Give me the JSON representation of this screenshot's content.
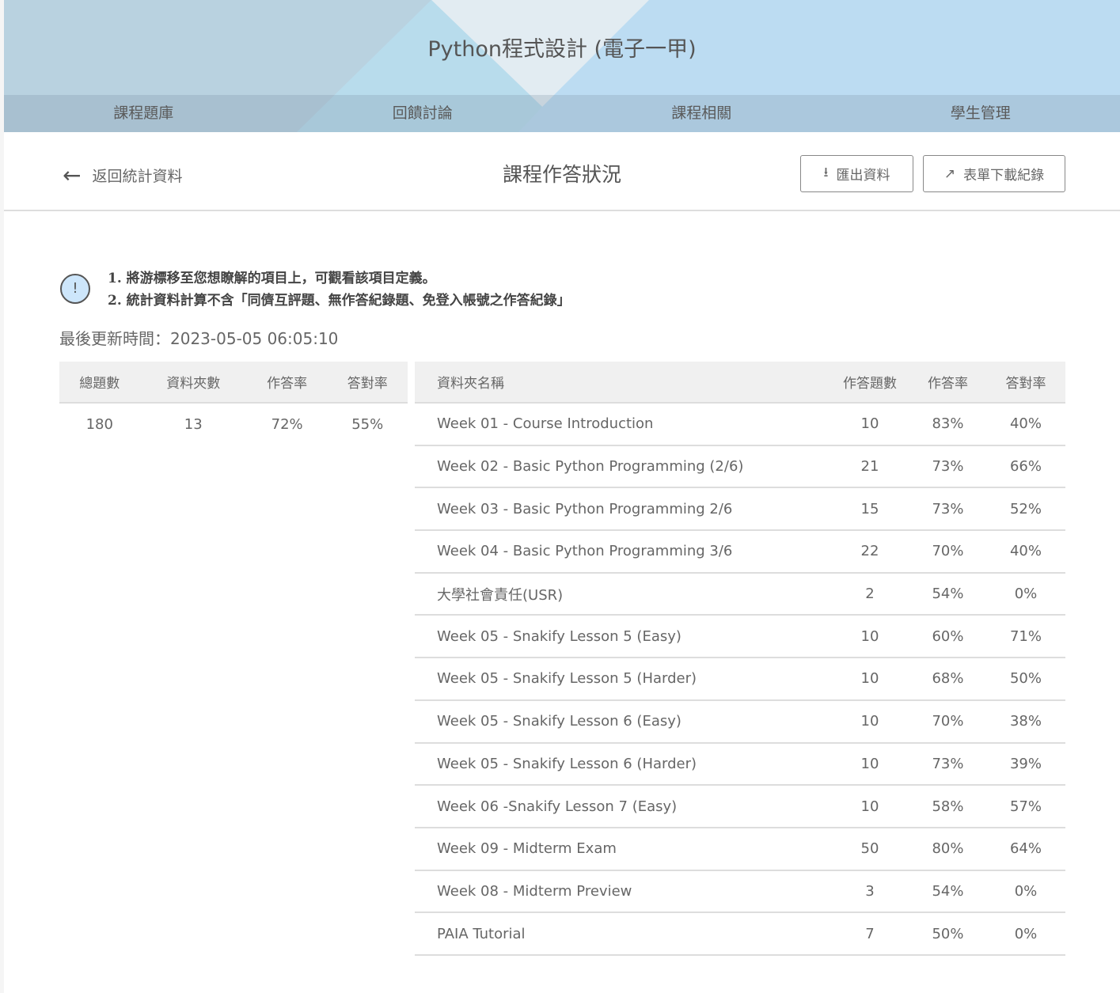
{
  "header": {
    "title": "Python程式設計 (電子一甲)",
    "nav": [
      "課程題庫",
      "回饋討論",
      "課程相關",
      "學生管理"
    ]
  },
  "toolbar": {
    "back": "返回統計資料",
    "title": "課程作答狀況",
    "export": "匯出資料",
    "form_log": "表單下載紀錄"
  },
  "notice": {
    "lines": [
      "1. 將游標移至您想瞭解的項目上，可觀看該項目定義。",
      "2. 統計資料計算不含「同儕互評題、無作答紀錄題、免登入帳號之作答紀錄」"
    ]
  },
  "updated": "最後更新時間：2023-05-05 06:05:10",
  "summary": {
    "headers": [
      "總題數",
      "資料夾數",
      "作答率",
      "答對率"
    ],
    "values": [
      "180",
      "13",
      "72%",
      "55%"
    ]
  },
  "folders": {
    "headers": [
      "資料夾名稱",
      "作答題數",
      "作答率",
      "答對率"
    ],
    "rows": [
      [
        "Week 01 - Course Introduction",
        "10",
        "83%",
        "40%"
      ],
      [
        "Week 02 - Basic Python Programming (2/6)",
        "21",
        "73%",
        "66%"
      ],
      [
        "Week 03 - Basic Python Programming 2/6",
        "15",
        "73%",
        "52%"
      ],
      [
        "Week 04 - Basic Python Programming 3/6",
        "22",
        "70%",
        "40%"
      ],
      [
        "大學社會責任(USR)",
        "2",
        "54%",
        "0%"
      ],
      [
        "Week 05 - Snakify Lesson 5 (Easy)",
        "10",
        "60%",
        "71%"
      ],
      [
        "Week 05 - Snakify Lesson 5 (Harder)",
        "10",
        "68%",
        "50%"
      ],
      [
        "Week 05 - Snakify Lesson 6 (Easy)",
        "10",
        "70%",
        "38%"
      ],
      [
        "Week 05 - Snakify Lesson 6 (Harder)",
        "10",
        "73%",
        "39%"
      ],
      [
        "Week 06 -Snakify Lesson 7 (Easy)",
        "10",
        "58%",
        "57%"
      ],
      [
        "Week 09 - Midterm Exam",
        "50",
        "80%",
        "64%"
      ],
      [
        "Week 08 - Midterm Preview",
        "3",
        "54%",
        "0%"
      ],
      [
        "PAIA Tutorial",
        "7",
        "50%",
        "0%"
      ]
    ]
  }
}
